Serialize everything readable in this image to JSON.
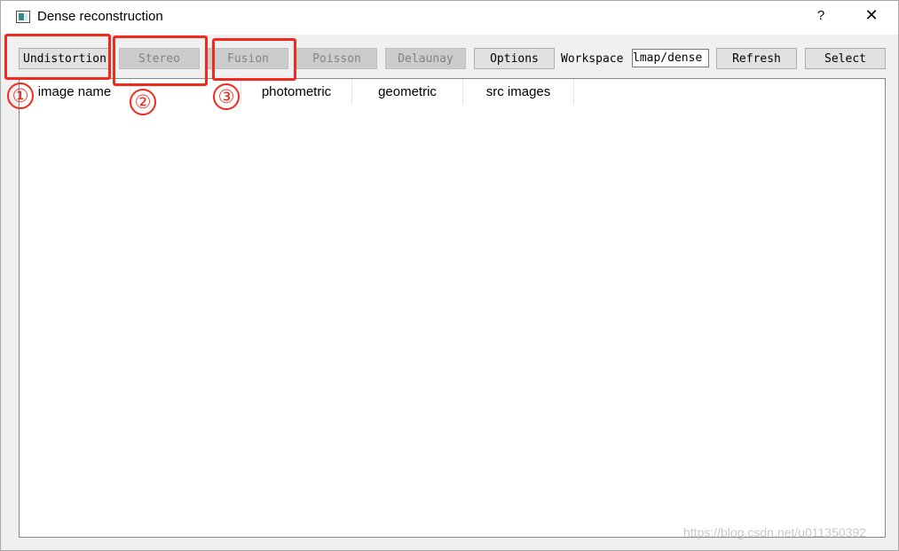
{
  "window": {
    "title": "Dense reconstruction",
    "help_label": "?",
    "close_label": "✕"
  },
  "toolbar": {
    "undistortion": "Undistortion",
    "stereo": "Stereo",
    "fusion": "Fusion",
    "poisson": "Poisson",
    "delaunay": "Delaunay",
    "options": "Options",
    "workspace_label": "Workspace",
    "workspace_value": "lmap/dense",
    "refresh": "Refresh",
    "select": "Select"
  },
  "table": {
    "columns": [
      "image name",
      "",
      "photometric",
      "geometric",
      "src images"
    ],
    "rows": []
  },
  "annotations": {
    "color": "#f22a1e",
    "markers": [
      "①",
      "②",
      "③"
    ]
  },
  "watermark": "https://blog.csdn.net/u011350392"
}
